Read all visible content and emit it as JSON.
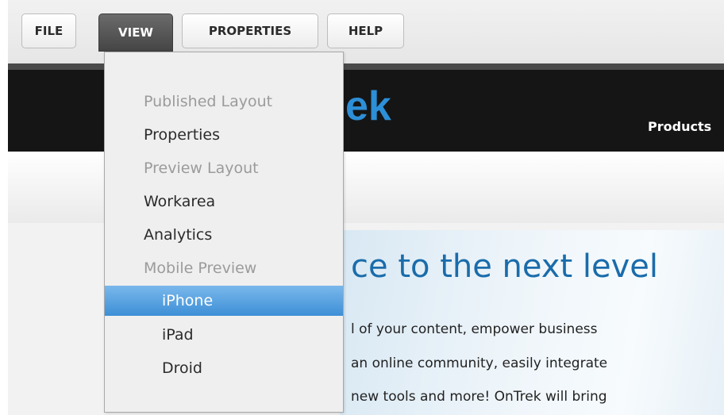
{
  "toolbar": {
    "file_label": "FILE",
    "view_label": "VIEW",
    "properties_label": "PROPERTIES",
    "help_label": "HELP"
  },
  "view_menu": {
    "items": [
      {
        "label": "Published Layout",
        "state": "disabled"
      },
      {
        "label": "Properties",
        "state": "enabled"
      },
      {
        "label": "Preview Layout",
        "state": "disabled"
      },
      {
        "label": "Workarea",
        "state": "enabled"
      },
      {
        "label": "Analytics",
        "state": "enabled"
      },
      {
        "label": "Mobile Preview",
        "state": "disabled"
      },
      {
        "label": "iPhone",
        "state": "selected"
      },
      {
        "label": "iPad",
        "state": "enabled"
      },
      {
        "label": "Droid",
        "state": "enabled"
      }
    ]
  },
  "site": {
    "logo_text": "ek",
    "nav_products": "Products",
    "hero_title": "ce to the next level",
    "hero_lines": [
      "l of your content, empower business",
      "an online community, easily integrate",
      "new tools and more! OnTrek will bring"
    ]
  },
  "colors": {
    "accent": "#3d8fd6",
    "logo": "#2d8fd7",
    "header_bg": "#151515",
    "hero_title": "#1a6cab"
  }
}
